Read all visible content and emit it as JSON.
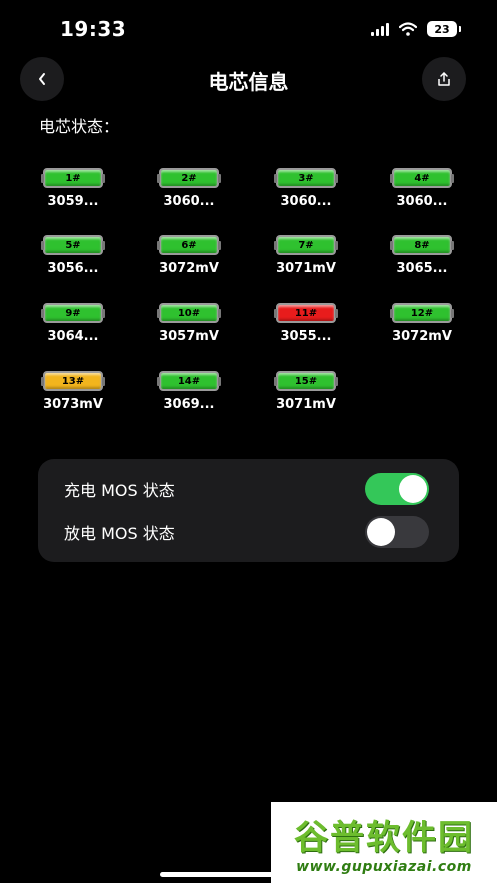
{
  "status_bar": {
    "time": "19:33",
    "battery": "23"
  },
  "header": {
    "title": "电芯信息",
    "back_icon": "chevron-left-icon",
    "share_icon": "share-icon"
  },
  "section": {
    "label": "电芯状态："
  },
  "colors": {
    "normal": "#2fc12f",
    "high": "#e81c1c",
    "low": "#f2b51d",
    "toggle_on": "#34c759",
    "toggle_off": "#39393d"
  },
  "cells": [
    {
      "label": "1#",
      "voltage": "3059...",
      "status": "normal"
    },
    {
      "label": "2#",
      "voltage": "3060...",
      "status": "normal"
    },
    {
      "label": "3#",
      "voltage": "3060...",
      "status": "normal"
    },
    {
      "label": "4#",
      "voltage": "3060...",
      "status": "normal"
    },
    {
      "label": "5#",
      "voltage": "3056...",
      "status": "normal"
    },
    {
      "label": "6#",
      "voltage": "3072mV",
      "status": "normal"
    },
    {
      "label": "7#",
      "voltage": "3071mV",
      "status": "normal"
    },
    {
      "label": "8#",
      "voltage": "3065...",
      "status": "normal"
    },
    {
      "label": "9#",
      "voltage": "3064...",
      "status": "normal"
    },
    {
      "label": "10#",
      "voltage": "3057mV",
      "status": "normal"
    },
    {
      "label": "11#",
      "voltage": "3055...",
      "status": "high"
    },
    {
      "label": "12#",
      "voltage": "3072mV",
      "status": "normal"
    },
    {
      "label": "13#",
      "voltage": "3073mV",
      "status": "low"
    },
    {
      "label": "14#",
      "voltage": "3069...",
      "status": "normal"
    },
    {
      "label": "15#",
      "voltage": "3071mV",
      "status": "normal"
    }
  ],
  "mos": {
    "charge": {
      "label": "充电 MOS 状态",
      "on": true
    },
    "discharge": {
      "label": "放电 MOS 状态",
      "on": false
    }
  },
  "watermark": {
    "title": "谷普软件园",
    "url": "www.gupuxiazai.com"
  }
}
